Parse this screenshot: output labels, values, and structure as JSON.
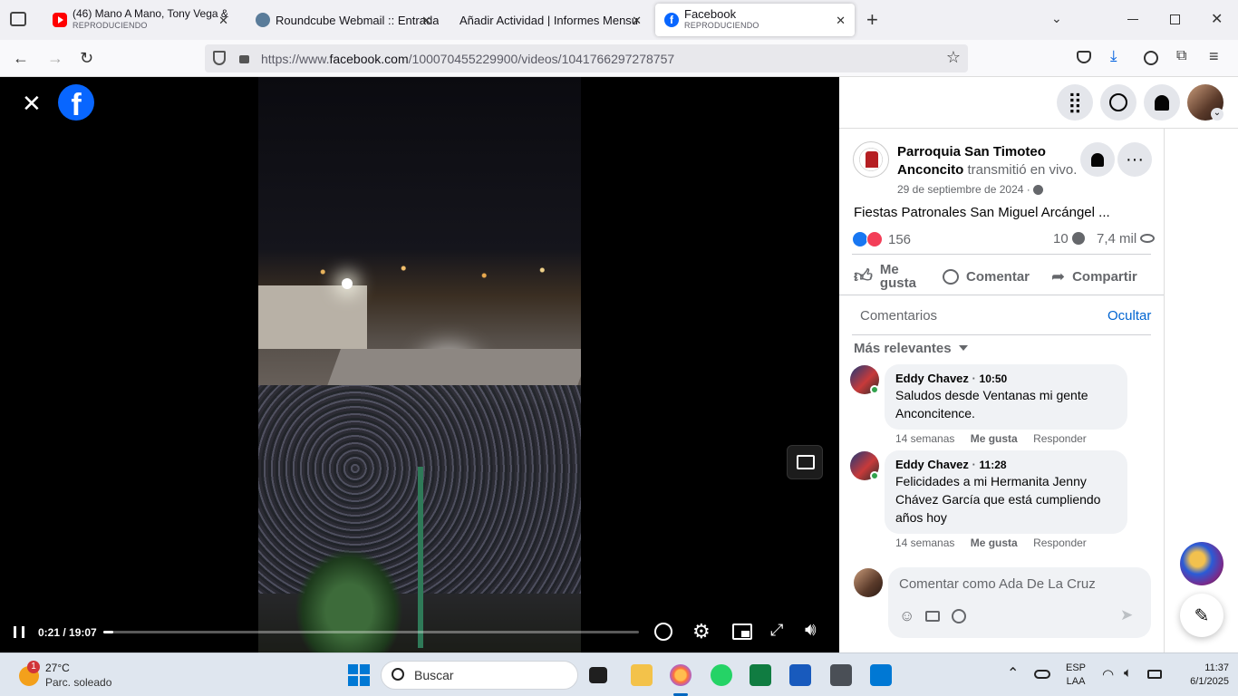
{
  "tabs": [
    {
      "title": "(46) Mano A Mano, Tony Vega &",
      "subtitle": "REPRODUCIENDO",
      "icon": "youtube-icon"
    },
    {
      "title": "Roundcube Webmail :: Entrada",
      "subtitle": "",
      "icon": "roundcube-icon"
    },
    {
      "title": "Añadir Actividad | Informes Mensu",
      "subtitle": "",
      "icon": ""
    },
    {
      "title": "Facebook",
      "subtitle": "REPRODUCIENDO",
      "icon": "facebook-icon"
    }
  ],
  "url": {
    "prefix": "https://www.",
    "domain": "facebook.com",
    "path": "/100070455229900/videos/1041766297278757"
  },
  "player": {
    "time": "0:21 / 19:07",
    "progress": 0.018
  },
  "post": {
    "page_name": "Parroquia San Timoteo Anconcito",
    "action": "transmitió en vivo.",
    "date": "29 de septiembre de 2024 ·",
    "caption": "Fiestas Patronales San Miguel Arcángel ...",
    "reactions": "156",
    "comments_count": "10",
    "views": "7,4 mil",
    "like_label": "Me gusta",
    "comment_label": "Comentar",
    "share_label": "Compartir"
  },
  "comments_section": {
    "title": "Comentarios",
    "hide_label": "Ocultar",
    "sort_label": "Más relevantes",
    "items": [
      {
        "author": "Eddy Chavez",
        "time": "10:50",
        "text": "Saludos desde Ventanas mi gente Anconcitence.",
        "age": "14 semanas",
        "like": "Me gusta",
        "reply": "Responder"
      },
      {
        "author": "Eddy Chavez",
        "time": "11:28",
        "text": "Felicidades a mi Hermanita Jenny Chávez García que está cumpliendo años hoy",
        "age": "14 semanas",
        "like": "Me gusta",
        "reply": "Responder"
      }
    ],
    "input_placeholder": "Comentar como Ada De La Cruz"
  },
  "taskbar": {
    "temp": "27°C",
    "weather": "Parc. soleado",
    "badge": "1",
    "search_placeholder": "Buscar",
    "lang": "ESP",
    "region": "LAA",
    "time": "11:37",
    "date": "6/1/2025"
  },
  "colors": {
    "facebook_blue": "#0866ff",
    "link_blue": "#0064d1",
    "progress": "#ffffff"
  }
}
